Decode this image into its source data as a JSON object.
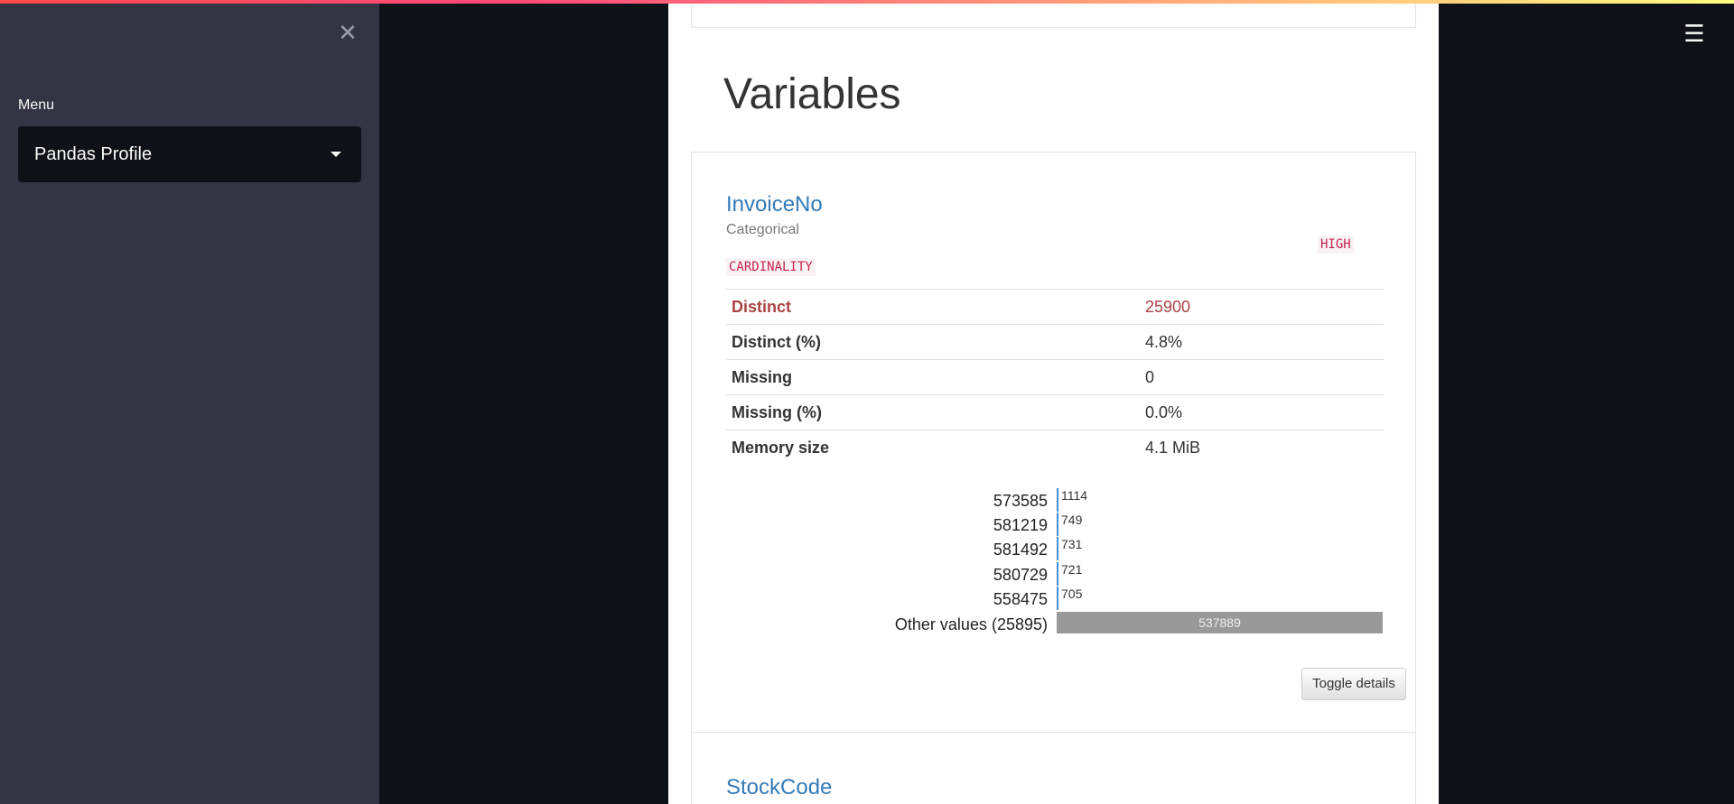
{
  "sidebar": {
    "close_glyph": "✕",
    "menu_label": "Menu",
    "menu_selected": "Pandas Profile"
  },
  "header": {
    "menu_glyph": "☰"
  },
  "main": {
    "section_title": "Variables",
    "variable": {
      "name": "InvoiceNo",
      "type": "Categorical",
      "badge_part1": "HIGH",
      "badge_part2": "CARDINALITY",
      "stats": [
        {
          "label": "Distinct",
          "value": "25900"
        },
        {
          "label": "Distinct (%)",
          "value": "4.8%"
        },
        {
          "label": "Missing",
          "value": "0"
        },
        {
          "label": "Missing (%)",
          "value": "0.0%"
        },
        {
          "label": "Memory size",
          "value": "4.1 MiB"
        }
      ],
      "frequencies": [
        {
          "label": "573585",
          "count": "1114"
        },
        {
          "label": "581219",
          "count": "749"
        },
        {
          "label": "581492",
          "count": "731"
        },
        {
          "label": "580729",
          "count": "721"
        },
        {
          "label": "558475",
          "count": "705"
        }
      ],
      "other": {
        "label": "Other values (25895)",
        "count": "537889"
      },
      "toggle_label": "Toggle details"
    },
    "next_variable": "StockCode"
  },
  "colors": {
    "accent_link": "#337ab7",
    "alert_text": "#a94442",
    "badge_text": "#c7254e",
    "sidebar_bg": "#333642",
    "app_bg": "#0e1117"
  }
}
